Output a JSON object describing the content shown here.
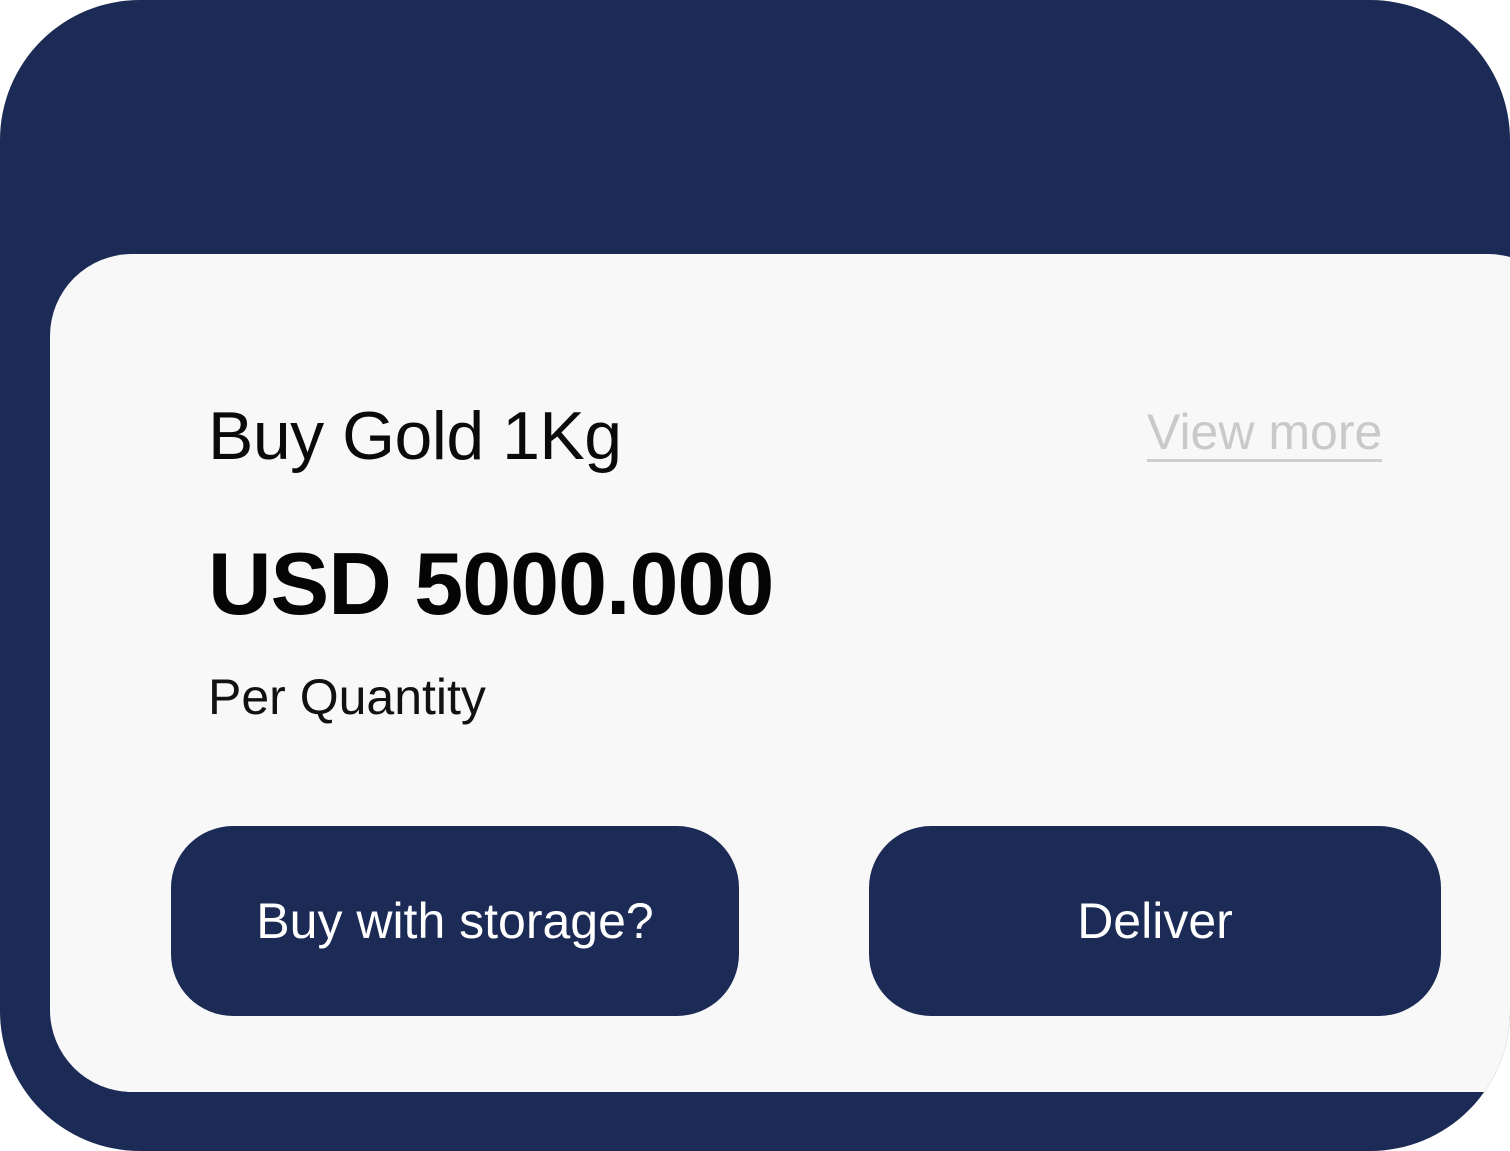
{
  "card": {
    "title": "Buy Gold 1Kg",
    "view_more_label": "View more",
    "price": "USD 5000.000",
    "price_unit": "Per Quantity"
  },
  "actions": {
    "storage_label": "Buy with storage?",
    "deliver_label": "Deliver"
  },
  "colors": {
    "brand_navy": "#1c2b56",
    "card_background": "#f8f8f8",
    "muted_link": "#c9c9c9"
  }
}
